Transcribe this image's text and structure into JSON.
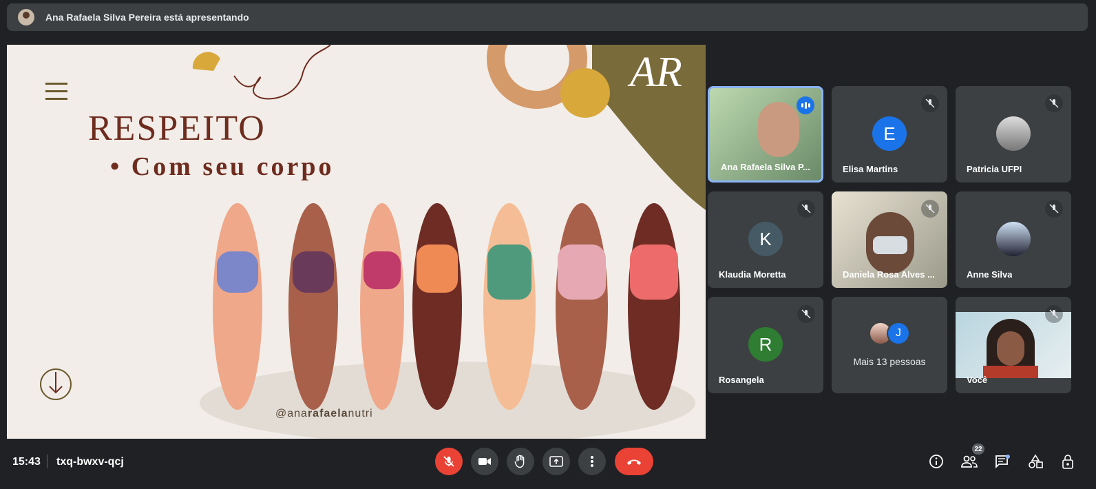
{
  "banner": {
    "presenting_text": "Ana Rafaela Silva Pereira está apresentando"
  },
  "slide": {
    "title": "RESPEITO",
    "subtitle": "• Com seu corpo",
    "handle_prefix": "@ana",
    "handle_bold": "rafaela",
    "handle_suffix": "nutri",
    "monogram": "AR"
  },
  "participants": [
    {
      "name": "Ana Rafaela Silva P...",
      "type": "video",
      "speaking": true
    },
    {
      "name": "Elisa Martins",
      "type": "letter",
      "letter": "E",
      "color": "#1a73e8"
    },
    {
      "name": "Patricia UFPI",
      "type": "photo"
    },
    {
      "name": "Klaudia Moretta",
      "type": "letter",
      "letter": "K",
      "color": "#455a64"
    },
    {
      "name": "Daniela Rosa Alves ...",
      "type": "video"
    },
    {
      "name": "Anne Silva",
      "type": "photo"
    },
    {
      "name": "Rosangela",
      "type": "letter",
      "letter": "R",
      "color": "#2e7d32"
    },
    {
      "more_text": "Mais 13 pessoas",
      "letter": "J"
    },
    {
      "name": "Você",
      "type": "video"
    }
  ],
  "bottom": {
    "time": "15:43",
    "meeting_code": "txq-bwxv-qcj",
    "people_count": "22"
  },
  "colors": {
    "accent": "#8ab4f8",
    "red": "#ea4335",
    "tile_bg": "#3c4043"
  }
}
